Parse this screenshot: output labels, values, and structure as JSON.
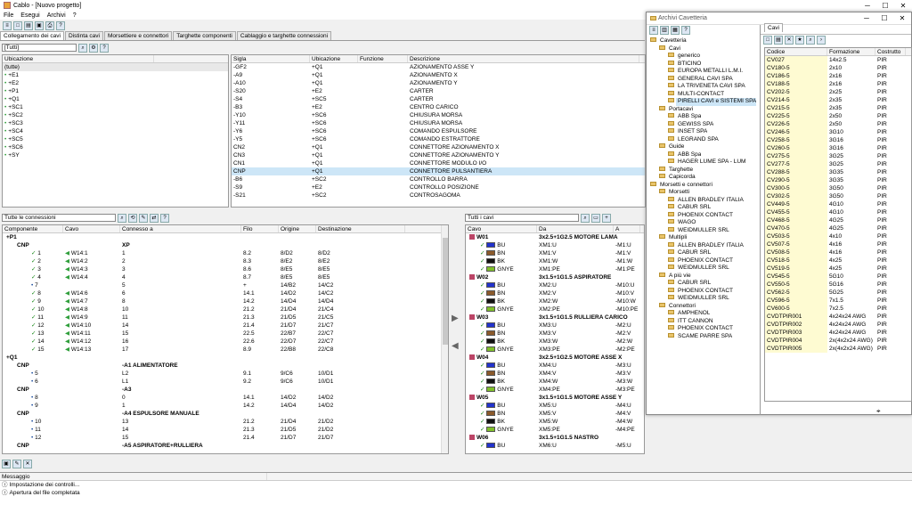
{
  "app": {
    "title": "Cablo - [Nuovo progetto]"
  },
  "menu": [
    "File",
    "Esegui",
    "Archivi",
    "?"
  ],
  "tabs": [
    "Collegamento dei cavi",
    "Distinta cavi",
    "Morsettiere e connettori",
    "Targhette componenti",
    "Cablaggio e targhette connessioni"
  ],
  "location_panel": {
    "filter": "[Tutti]",
    "header": "Ubicazione",
    "items": [
      "(tutte)",
      "+E1",
      "+E2",
      "+P1",
      "+Q1",
      "+SC1",
      "+SC2",
      "+SC3",
      "+SC4",
      "+SC5",
      "+SC6",
      "+SY"
    ]
  },
  "components_panel": {
    "headers": [
      "Sigla",
      "Ubicazione",
      "Funzione",
      "Descrizione"
    ],
    "rows": [
      [
        "-GF2",
        "+Q1",
        "",
        "AZIONAMENTO ASSE Y"
      ],
      [
        "-A9",
        "+Q1",
        "",
        "AZIONAMENTO X"
      ],
      [
        "-A10",
        "+Q1",
        "",
        "AZIONAMENTO Y"
      ],
      [
        "-S20",
        "+E2",
        "",
        "CARTER"
      ],
      [
        "-S4",
        "+SC5",
        "",
        "CARTER"
      ],
      [
        "-B3",
        "+E2",
        "",
        "CENTRO CARICO"
      ],
      [
        "-Y10",
        "+SC6",
        "",
        "CHIUSURA MORSA"
      ],
      [
        "-Y11",
        "+SC6",
        "",
        "CHIUSURA MORSA"
      ],
      [
        "-Y6",
        "+SC6",
        "",
        "COMANDO ESPULSORE"
      ],
      [
        "-Y5",
        "+SC6",
        "",
        "COMANDO ESTRATTORE"
      ],
      [
        "CN2",
        "+Q1",
        "",
        "CONNETTORE AZIONAMENTO X"
      ],
      [
        "CN3",
        "+Q1",
        "",
        "CONNETTORE AZIONAMENTO Y"
      ],
      [
        "CN1",
        "+Q1",
        "",
        "CONNETTORE MODULO I/O"
      ],
      [
        "CNP",
        "+Q1",
        "",
        "CONNETTORE PULSANTIERA"
      ],
      [
        "-B6",
        "+SC2",
        "",
        "CONTROLLO BARRA"
      ],
      [
        "-S9",
        "+E2",
        "",
        "CONTROLLO POSIZIONE"
      ],
      [
        "-S21",
        "+SC2",
        "",
        "CONTROSAGOMA"
      ]
    ]
  },
  "connections_panel": {
    "filter": "Tutte le connessioni",
    "headers": [
      "Componente",
      "Cavo",
      "Connesso a",
      "Filo",
      "Origine",
      "Destinazione"
    ],
    "rows": [
      {
        "t": "group",
        "c": "+P1"
      },
      {
        "t": "sub",
        "c": "CNP",
        "k": "XP"
      },
      {
        "t": "pin",
        "c": "1",
        "v": "W14:1",
        "k": "1",
        "f": "8.2",
        "o": "8/D2",
        "d": "8/D2"
      },
      {
        "t": "pin",
        "c": "2",
        "v": "W14:2",
        "k": "2",
        "f": "8.3",
        "o": "8/E2",
        "d": "8/E2"
      },
      {
        "t": "pin",
        "c": "3",
        "v": "W14:3",
        "k": "3",
        "f": "8.6",
        "o": "8/E5",
        "d": "8/E5"
      },
      {
        "t": "pin",
        "c": "4",
        "v": "W14:4",
        "k": "4",
        "f": "8.7",
        "o": "8/E5",
        "d": "8/E5"
      },
      {
        "t": "pin2",
        "c": "7",
        "v": "",
        "k": "5",
        "f": "+",
        "o": "14/B2",
        "d": "14/C2"
      },
      {
        "t": "pin",
        "c": "8",
        "v": "W14:6",
        "k": "6",
        "f": "14.1",
        "o": "14/D2",
        "d": "14/C2"
      },
      {
        "t": "pin",
        "c": "9",
        "v": "W14:7",
        "k": "8",
        "f": "14.2",
        "o": "14/D4",
        "d": "14/D4"
      },
      {
        "t": "pin",
        "c": "10",
        "v": "W14:8",
        "k": "10",
        "f": "21.2",
        "o": "21/D4",
        "d": "21/C4"
      },
      {
        "t": "pin",
        "c": "11",
        "v": "W14:9",
        "k": "11",
        "f": "21.3",
        "o": "21/D5",
        "d": "21/C5"
      },
      {
        "t": "pin",
        "c": "12",
        "v": "W14:10",
        "k": "14",
        "f": "21.4",
        "o": "21/D7",
        "d": "21/C7"
      },
      {
        "t": "pin",
        "c": "13",
        "v": "W14:11",
        "k": "15",
        "f": "22.5",
        "o": "22/B7",
        "d": "22/C7"
      },
      {
        "t": "pin",
        "c": "14",
        "v": "W14:12",
        "k": "16",
        "f": "22.6",
        "o": "22/D7",
        "d": "22/C7"
      },
      {
        "t": "pin",
        "c": "15",
        "v": "W14:13",
        "k": "17",
        "f": "8.9",
        "o": "22/B8",
        "d": "22/C8"
      },
      {
        "t": "group",
        "c": "+Q1"
      },
      {
        "t": "sub",
        "c": "CNP",
        "k": "-A1 ALIMENTATORE"
      },
      {
        "t": "pin2",
        "c": "5",
        "v": "",
        "k": "L2",
        "f": "9.1",
        "o": "9/C6",
        "d": "10/D1"
      },
      {
        "t": "pin2",
        "c": "6",
        "v": "",
        "k": "L1",
        "f": "9.2",
        "o": "9/C6",
        "d": "10/D1"
      },
      {
        "t": "sub",
        "c": "CNP",
        "k": "-A3"
      },
      {
        "t": "pin2",
        "c": "8",
        "v": "",
        "k": "0",
        "f": "14.1",
        "o": "14/D2",
        "d": "14/D2"
      },
      {
        "t": "pin2",
        "c": "9",
        "v": "",
        "k": "1",
        "f": "14.2",
        "o": "14/D4",
        "d": "14/D2"
      },
      {
        "t": "sub",
        "c": "CNP",
        "k": "-A4 ESPULSORE MANUALE"
      },
      {
        "t": "pin2",
        "c": "10",
        "v": "",
        "k": "13",
        "f": "21.2",
        "o": "21/D4",
        "d": "21/D2"
      },
      {
        "t": "pin2",
        "c": "11",
        "v": "",
        "k": "14",
        "f": "21.3",
        "o": "21/D5",
        "d": "21/D2"
      },
      {
        "t": "pin2",
        "c": "12",
        "v": "",
        "k": "15",
        "f": "21.4",
        "o": "21/D7",
        "d": "21/D7"
      },
      {
        "t": "sub",
        "c": "CNP",
        "k": "-A5 ASPIRATORE+RULLIERA"
      }
    ]
  },
  "cables_panel": {
    "filter": "Tutti i cavi",
    "headers": [
      "Cavo",
      "Da",
      "A"
    ],
    "rows": [
      {
        "t": "cab",
        "c": "W01",
        "n": "3x2.5+1G2.5 MOTORE LAMA"
      },
      {
        "t": "w",
        "col": "#2233cc",
        "n": "BU",
        "da": "XM1:U",
        "a": "-M1:U"
      },
      {
        "t": "w",
        "col": "#8b5a2b",
        "n": "BN",
        "da": "XM1:V",
        "a": "-M1:V"
      },
      {
        "t": "w",
        "col": "#111111",
        "n": "BK",
        "da": "XM1:W",
        "a": "-M1:W"
      },
      {
        "t": "w",
        "col": "#7fbf2a",
        "n": "GNYE",
        "da": "XM1:PE",
        "a": "-M1:PE"
      },
      {
        "t": "cab",
        "c": "W02",
        "n": "3x1.5+1G1.5 ASPIRATORE"
      },
      {
        "t": "w",
        "col": "#2233cc",
        "n": "BU",
        "da": "XM2:U",
        "a": "-M10:U"
      },
      {
        "t": "w",
        "col": "#8b5a2b",
        "n": "BN",
        "da": "XM2:V",
        "a": "-M10:V"
      },
      {
        "t": "w",
        "col": "#111111",
        "n": "BK",
        "da": "XM2:W",
        "a": "-M10:W"
      },
      {
        "t": "w",
        "col": "#7fbf2a",
        "n": "GNYE",
        "da": "XM2:PE",
        "a": "-M10:PE"
      },
      {
        "t": "cab",
        "c": "W03",
        "n": "3x1.5+1G1.5 RULLIERA CARICO"
      },
      {
        "t": "w",
        "col": "#2233cc",
        "n": "BU",
        "da": "XM3:U",
        "a": "-M2:U"
      },
      {
        "t": "w",
        "col": "#8b5a2b",
        "n": "BN",
        "da": "XM3:V",
        "a": "-M2:V"
      },
      {
        "t": "w",
        "col": "#111111",
        "n": "BK",
        "da": "XM3:W",
        "a": "-M2:W"
      },
      {
        "t": "w",
        "col": "#7fbf2a",
        "n": "GNYE",
        "da": "XM3:PE",
        "a": "-M2:PE"
      },
      {
        "t": "cab",
        "c": "W04",
        "n": "3x2.5+1G2.5 MOTORE ASSE X"
      },
      {
        "t": "w",
        "col": "#2233cc",
        "n": "BU",
        "da": "XM4:U",
        "a": "-M3:U"
      },
      {
        "t": "w",
        "col": "#8b5a2b",
        "n": "BN",
        "da": "XM4:V",
        "a": "-M3:V"
      },
      {
        "t": "w",
        "col": "#111111",
        "n": "BK",
        "da": "XM4:W",
        "a": "-M3:W"
      },
      {
        "t": "w",
        "col": "#7fbf2a",
        "n": "GNYE",
        "da": "XM4:PE",
        "a": "-M3:PE"
      },
      {
        "t": "cab",
        "c": "W05",
        "n": "3x1.5+1G1.5 MOTORE ASSE Y"
      },
      {
        "t": "w",
        "col": "#2233cc",
        "n": "BU",
        "da": "XM5:U",
        "a": "-M4:U"
      },
      {
        "t": "w",
        "col": "#8b5a2b",
        "n": "BN",
        "da": "XM5:V",
        "a": "-M4:V"
      },
      {
        "t": "w",
        "col": "#111111",
        "n": "BK",
        "da": "XM5:W",
        "a": "-M4:W"
      },
      {
        "t": "w",
        "col": "#7fbf2a",
        "n": "GNYE",
        "da": "XM5:PE",
        "a": "-M4:PE"
      },
      {
        "t": "cab",
        "c": "W06",
        "n": "3x1.5+1G1.5 NASTRO"
      },
      {
        "t": "w",
        "col": "#2233cc",
        "n": "BU",
        "da": "XM6:U",
        "a": "-M5:U"
      }
    ]
  },
  "archive": {
    "title": "Archivi Cavetteria",
    "tab": "Cavi",
    "tree": [
      {
        "l": 0,
        "n": "Cavetteria"
      },
      {
        "l": 1,
        "n": "Cavi"
      },
      {
        "l": 2,
        "n": "generico"
      },
      {
        "l": 2,
        "n": "BTICINO"
      },
      {
        "l": 2,
        "n": "EUROPA METALLI L.M.I."
      },
      {
        "l": 2,
        "n": "GENERAL CAVI SPA"
      },
      {
        "l": 2,
        "n": "LA TRIVENETA CAVI SPA"
      },
      {
        "l": 2,
        "n": "MULTI-CONTACT"
      },
      {
        "l": 2,
        "n": "PIRELLI CAVI e SISTEMI SPA",
        "sel": true
      },
      {
        "l": 1,
        "n": "Portacavi"
      },
      {
        "l": 2,
        "n": "ABB Spa"
      },
      {
        "l": 2,
        "n": "GEWISS SPA"
      },
      {
        "l": 2,
        "n": "INSET SPA"
      },
      {
        "l": 2,
        "n": "LEGRAND SPA"
      },
      {
        "l": 1,
        "n": "Guide"
      },
      {
        "l": 2,
        "n": "ABB Spa"
      },
      {
        "l": 2,
        "n": "HAGER LUME SPA - LUM"
      },
      {
        "l": 1,
        "n": "Targhette"
      },
      {
        "l": 1,
        "n": "Capicorda"
      },
      {
        "l": 0,
        "n": "Morsetti e connettori"
      },
      {
        "l": 1,
        "n": "Morsetti"
      },
      {
        "l": 2,
        "n": "ALLEN BRADLEY ITALIA"
      },
      {
        "l": 2,
        "n": "CABUR SRL"
      },
      {
        "l": 2,
        "n": "PHOENIX CONTACT"
      },
      {
        "l": 2,
        "n": "WAGO"
      },
      {
        "l": 2,
        "n": "WEIDMULLER SRL"
      },
      {
        "l": 1,
        "n": "Multipli"
      },
      {
        "l": 2,
        "n": "ALLEN BRADLEY ITALIA"
      },
      {
        "l": 2,
        "n": "CABUR SRL"
      },
      {
        "l": 2,
        "n": "PHOENIX CONTACT"
      },
      {
        "l": 2,
        "n": "WEIDMULLER SRL"
      },
      {
        "l": 1,
        "n": "A più vie"
      },
      {
        "l": 2,
        "n": "CABUR SRL"
      },
      {
        "l": 2,
        "n": "PHOENIX CONTACT"
      },
      {
        "l": 2,
        "n": "WEIDMULLER SRL"
      },
      {
        "l": 1,
        "n": "Connettori"
      },
      {
        "l": 2,
        "n": "AMPHENOL"
      },
      {
        "l": 2,
        "n": "ITT CANNON"
      },
      {
        "l": 2,
        "n": "PHOENIX CONTACT"
      },
      {
        "l": 2,
        "n": "SCAME PARRE SPA"
      }
    ],
    "headers": [
      "Codice",
      "Formazione",
      "Costrutto"
    ],
    "rows": [
      [
        "CV027",
        "14x2.5",
        "PIR"
      ],
      [
        "CV180-5",
        "2x10",
        "PIR"
      ],
      [
        "CV186-5",
        "2x16",
        "PIR"
      ],
      [
        "CV188-5",
        "2x16",
        "PIR"
      ],
      [
        "CV202-5",
        "2x25",
        "PIR"
      ],
      [
        "CV214-5",
        "2x35",
        "PIR"
      ],
      [
        "CV215-5",
        "2x35",
        "PIR"
      ],
      [
        "CV225-5",
        "2x50",
        "PIR"
      ],
      [
        "CV226-5",
        "2x50",
        "PIR"
      ],
      [
        "CV246-5",
        "3G10",
        "PIR"
      ],
      [
        "CV258-5",
        "3G16",
        "PIR"
      ],
      [
        "CV260-5",
        "3G16",
        "PIR"
      ],
      [
        "CV275-5",
        "3G25",
        "PIR"
      ],
      [
        "CV277-5",
        "3G25",
        "PIR"
      ],
      [
        "CV288-5",
        "3G35",
        "PIR"
      ],
      [
        "CV290-5",
        "3G35",
        "PIR"
      ],
      [
        "CV300-5",
        "3G50",
        "PIR"
      ],
      [
        "CV302-5",
        "3G50",
        "PIR"
      ],
      [
        "CV449-5",
        "4G10",
        "PIR"
      ],
      [
        "CV455-5",
        "4G10",
        "PIR"
      ],
      [
        "CV468-5",
        "4G25",
        "PIR"
      ],
      [
        "CV470-5",
        "4G25",
        "PIR"
      ],
      [
        "CV503-5",
        "4x10",
        "PIR"
      ],
      [
        "CV507-5",
        "4x16",
        "PIR"
      ],
      [
        "CV508-5",
        "4x16",
        "PIR"
      ],
      [
        "CV518-5",
        "4x25",
        "PIR"
      ],
      [
        "CV519-5",
        "4x25",
        "PIR"
      ],
      [
        "CV545-5",
        "5G10",
        "PIR"
      ],
      [
        "CV550-5",
        "5G16",
        "PIR"
      ],
      [
        "CV562-5",
        "5G25",
        "PIR"
      ],
      [
        "CV596-5",
        "7x1.5",
        "PIR"
      ],
      [
        "CV600-5",
        "7x2.5",
        "PIR"
      ],
      [
        "CVDTPIR001",
        "4x24x24 AWG",
        "PIR"
      ],
      [
        "CVDTPIR002",
        "4x24x24 AWG",
        "PIR"
      ],
      [
        "CVDTPIR003",
        "4x24x24 AWG",
        "PIR"
      ],
      [
        "CVDTPIR004",
        "2x(4x2x24 AWG)",
        "PIR"
      ],
      [
        "CVDTPIR005",
        "2x(4x2x24 AWG)",
        "PIR"
      ]
    ]
  },
  "messages": {
    "header": "Messaggio",
    "items": [
      "Impostazione dei controlli...",
      "Apertura del file completata"
    ]
  }
}
